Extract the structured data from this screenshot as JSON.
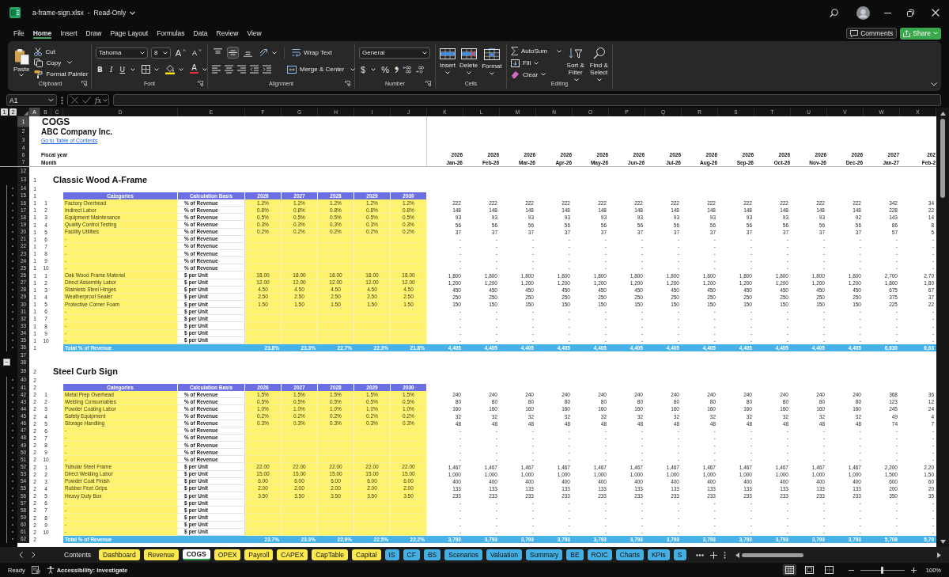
{
  "window": {
    "file_name": "a-frame-sign.xlsx",
    "separator": "-",
    "mode": "Read-Only"
  },
  "menu": {
    "tabs": [
      {
        "label": "File",
        "selected": false
      },
      {
        "label": "Home",
        "selected": true
      },
      {
        "label": "Insert",
        "selected": false
      },
      {
        "label": "Draw",
        "selected": false
      },
      {
        "label": "Page Layout",
        "selected": false
      },
      {
        "label": "Formulas",
        "selected": false
      },
      {
        "label": "Data",
        "selected": false
      },
      {
        "label": "Review",
        "selected": false
      },
      {
        "label": "View",
        "selected": false
      }
    ],
    "comments": "Comments",
    "share": "Share"
  },
  "ribbon": {
    "clipboard": {
      "paste": "Paste",
      "cut": "Cut",
      "copy": "Copy",
      "format_painter": "Format Painter",
      "label": "Clipboard"
    },
    "font": {
      "font_name": "Tahoma",
      "font_size": "8",
      "grow": "A",
      "shrink": "A",
      "bold": "B",
      "italic": "I",
      "underline": "U",
      "font_color": "A",
      "label": "Font"
    },
    "alignment": {
      "vertical": [
        {
          "kind": "top",
          "selected": false
        },
        {
          "kind": "middle",
          "selected": true
        },
        {
          "kind": "bottom",
          "selected": false
        }
      ],
      "wrap_text": "Wrap Text",
      "merge": "Merge & Center",
      "label": "Alignment"
    },
    "number": {
      "format": "General",
      "currency": "$",
      "percent": "%",
      "label": "Number"
    },
    "cells": {
      "insert": "Insert",
      "delete": "Delete",
      "format": "Format",
      "label": "Cells"
    },
    "editing": {
      "autosum": "AutoSum",
      "fill": "Fill",
      "clear": "Clear",
      "sort_filter": "Sort & Filter",
      "find_select": "Find & Select",
      "label": "Editing"
    }
  },
  "formula_bar": {
    "name_box": "A1",
    "function_label": "fx"
  },
  "sheet": {
    "outline_levels": [
      "1",
      "2"
    ],
    "columns": [
      {
        "label": "A",
        "selected": true
      },
      {
        "label": "B",
        "selected": false
      },
      {
        "label": "C",
        "selected": false
      },
      {
        "label": "D",
        "selected": false
      },
      {
        "label": "E",
        "selected": false
      },
      {
        "label": "F",
        "selected": false
      },
      {
        "label": "G",
        "selected": false
      },
      {
        "label": "H",
        "selected": false
      },
      {
        "label": "I",
        "selected": false
      },
      {
        "label": "J",
        "selected": false
      },
      {
        "label": "K",
        "selected": false
      },
      {
        "label": "L",
        "selected": false
      },
      {
        "label": "M",
        "selected": false
      },
      {
        "label": "N",
        "selected": false
      },
      {
        "label": "O",
        "selected": false
      },
      {
        "label": "P",
        "selected": false
      },
      {
        "label": "Q",
        "selected": false
      },
      {
        "label": "R",
        "selected": false
      },
      {
        "label": "S",
        "selected": false
      },
      {
        "label": "T",
        "selected": false
      },
      {
        "label": "U",
        "selected": false
      },
      {
        "label": "V",
        "selected": false
      },
      {
        "label": "W",
        "selected": false
      },
      {
        "label": "X",
        "selected": false
      }
    ],
    "frozen_rows": [
      {
        "number": "1",
        "kind": "title",
        "selected": true,
        "text": "COGS"
      },
      {
        "number": "2",
        "kind": "company",
        "selected": false,
        "text": "ABC Company Inc."
      },
      {
        "number": "3",
        "kind": "link",
        "selected": false,
        "text": "Go to Table of Contents"
      },
      {
        "number": "4",
        "kind": "blank",
        "selected": false
      },
      {
        "number": "6",
        "kind": "label",
        "selected": false,
        "text": "Fiscal year",
        "monthly": [
          "2026",
          "2026",
          "2026",
          "2026",
          "2026",
          "2026",
          "2026",
          "2026",
          "2026",
          "2026",
          "2026",
          "2026",
          "2027",
          "202"
        ]
      },
      {
        "number": "7",
        "kind": "label",
        "selected": false,
        "text": "Month",
        "monthly": [
          "Jan-26",
          "Feb-26",
          "Mar-26",
          "Apr-26",
          "May-26",
          "Jun-26",
          "Jul-26",
          "Aug-26",
          "Sep-26",
          "Oct-26",
          "Nov-26",
          "Dec-26",
          "Jan-27",
          "Feb-2"
        ]
      }
    ],
    "rows": [
      {
        "number": "12",
        "kind": "blank",
        "selected": false
      },
      {
        "number": "13",
        "kind": "section",
        "selected": false,
        "group": "1",
        "text": "Classic Wood A-Frame"
      },
      {
        "number": "14",
        "kind": "blank",
        "selected": false,
        "group": "1"
      },
      {
        "number": "15",
        "kind": "header",
        "selected": false,
        "group": "1",
        "category": "Categories",
        "basis": "Calculation Basis",
        "annual": [
          "2026",
          "2027",
          "2028",
          "2029",
          "2030"
        ]
      },
      {
        "number": "16",
        "kind": "item",
        "selected": false,
        "group": "1",
        "index": "1",
        "category": "Factory Overhead",
        "basis": "% of Revenue",
        "annual": [
          "1.2%",
          "1.2%",
          "1.2%",
          "1.2%",
          "1.2%"
        ],
        "monthly": [
          "222",
          "222",
          "222",
          "222",
          "222",
          "222",
          "222",
          "222",
          "222",
          "222",
          "222",
          "222",
          "342",
          "34"
        ]
      },
      {
        "number": "17",
        "kind": "item",
        "selected": false,
        "group": "1",
        "index": "2",
        "category": "Indirect Labor",
        "basis": "% of Revenue",
        "annual": [
          "0.8%",
          "0.8%",
          "0.8%",
          "0.8%",
          "0.8%"
        ],
        "monthly": [
          "148",
          "148",
          "148",
          "148",
          "148",
          "148",
          "148",
          "148",
          "148",
          "148",
          "148",
          "148",
          "228",
          "22"
        ]
      },
      {
        "number": "18",
        "kind": "item",
        "selected": false,
        "group": "1",
        "index": "3",
        "category": "Equipment Maintenance",
        "basis": "% of Revenue",
        "annual": [
          "0.5%",
          "0.5%",
          "0.5%",
          "0.5%",
          "0.5%"
        ],
        "monthly": [
          "93",
          "93",
          "93",
          "93",
          "93",
          "93",
          "93",
          "93",
          "93",
          "93",
          "93",
          "92",
          "143",
          "14"
        ]
      },
      {
        "number": "19",
        "kind": "item",
        "selected": false,
        "group": "1",
        "index": "4",
        "category": "Quality Control Testing",
        "basis": "% of Revenue",
        "annual": [
          "0.3%",
          "0.3%",
          "0.3%",
          "0.3%",
          "0.3%"
        ],
        "monthly": [
          "56",
          "56",
          "56",
          "56",
          "56",
          "56",
          "56",
          "56",
          "56",
          "56",
          "56",
          "56",
          "86",
          "8"
        ]
      },
      {
        "number": "20",
        "kind": "item",
        "selected": false,
        "group": "1",
        "index": "5",
        "category": "Facility Utilities",
        "basis": "% of Revenue",
        "annual": [
          "0.2%",
          "0.2%",
          "0.2%",
          "0.2%",
          "0.2%"
        ],
        "monthly": [
          "37",
          "37",
          "37",
          "37",
          "37",
          "37",
          "37",
          "37",
          "37",
          "37",
          "37",
          "37",
          "57",
          "5"
        ]
      },
      {
        "number": "21",
        "kind": "item",
        "selected": false,
        "group": "1",
        "index": "6",
        "category": "-",
        "basis": "% of Revenue",
        "monthly": [
          "-",
          "-",
          "-",
          "-",
          "-",
          "-",
          "-",
          "-",
          "-",
          "-",
          "-",
          "-",
          "-",
          "-"
        ]
      },
      {
        "number": "22",
        "kind": "item",
        "selected": false,
        "group": "1",
        "index": "7",
        "category": "-",
        "basis": "% of Revenue",
        "monthly": [
          "-",
          "-",
          "-",
          "-",
          "-",
          "-",
          "-",
          "-",
          "-",
          "-",
          "-",
          "-",
          "-",
          "-"
        ]
      },
      {
        "number": "23",
        "kind": "item",
        "selected": false,
        "group": "1",
        "index": "8",
        "category": "-",
        "basis": "% of Revenue",
        "monthly": [
          "-",
          "-",
          "-",
          "-",
          "-",
          "-",
          "-",
          "-",
          "-",
          "-",
          "-",
          "-",
          "-",
          "-"
        ]
      },
      {
        "number": "24",
        "kind": "item",
        "selected": false,
        "group": "1",
        "index": "9",
        "category": "-",
        "basis": "% of Revenue",
        "monthly": [
          "-",
          "-",
          "-",
          "-",
          "-",
          "-",
          "-",
          "-",
          "-",
          "-",
          "-",
          "-",
          "-",
          "-"
        ]
      },
      {
        "number": "25",
        "kind": "item",
        "selected": false,
        "group": "1",
        "index": "10",
        "category": "-",
        "basis": "% of Revenue",
        "monthly": [
          "-",
          "-",
          "-",
          "-",
          "-",
          "-",
          "-",
          "-",
          "-",
          "-",
          "-",
          "-",
          "-",
          "-"
        ]
      },
      {
        "number": "26",
        "kind": "item",
        "selected": false,
        "group": "1",
        "index": "1",
        "category": "Oak Wood Frame Material",
        "basis": "$ per Unit",
        "annual": [
          "18.00",
          "18.00",
          "18.00",
          "18.00",
          "18.00"
        ],
        "monthly": [
          "1,800",
          "1,800",
          "1,800",
          "1,800",
          "1,800",
          "1,800",
          "1,800",
          "1,800",
          "1,800",
          "1,800",
          "1,800",
          "1,800",
          "2,700",
          "2,70"
        ]
      },
      {
        "number": "27",
        "kind": "item",
        "selected": false,
        "group": "1",
        "index": "2",
        "category": "Direct Assembly Labor",
        "basis": "$ per Unit",
        "annual": [
          "12.00",
          "12.00",
          "12.00",
          "12.00",
          "12.00"
        ],
        "monthly": [
          "1,200",
          "1,200",
          "1,200",
          "1,200",
          "1,200",
          "1,200",
          "1,200",
          "1,200",
          "1,200",
          "1,200",
          "1,200",
          "1,200",
          "1,800",
          "1,80"
        ]
      },
      {
        "number": "28",
        "kind": "item",
        "selected": false,
        "group": "1",
        "index": "3",
        "category": "Stainless Steel Hinges",
        "basis": "$ per Unit",
        "annual": [
          "4.50",
          "4.50",
          "4.50",
          "4.50",
          "4.50"
        ],
        "monthly": [
          "450",
          "450",
          "450",
          "450",
          "450",
          "450",
          "450",
          "450",
          "450",
          "450",
          "450",
          "450",
          "675",
          "67"
        ]
      },
      {
        "number": "29",
        "kind": "item",
        "selected": false,
        "group": "1",
        "index": "4",
        "category": "Weatherproof Sealer",
        "basis": "$ per Unit",
        "annual": [
          "2.50",
          "2.50",
          "2.50",
          "2.50",
          "2.50"
        ],
        "monthly": [
          "250",
          "250",
          "250",
          "250",
          "250",
          "250",
          "250",
          "250",
          "250",
          "250",
          "250",
          "250",
          "375",
          "37"
        ]
      },
      {
        "number": "30",
        "kind": "item",
        "selected": false,
        "group": "1",
        "index": "5",
        "category": "Protective Corner Foam",
        "basis": "$ per Unit",
        "annual": [
          "1.50",
          "1.50",
          "1.50",
          "1.50",
          "1.50"
        ],
        "monthly": [
          "150",
          "150",
          "150",
          "150",
          "150",
          "150",
          "150",
          "150",
          "150",
          "150",
          "150",
          "150",
          "225",
          "22"
        ]
      },
      {
        "number": "31",
        "kind": "item",
        "selected": false,
        "group": "1",
        "index": "6",
        "category": "-",
        "basis": "$ per Unit",
        "monthly": [
          "-",
          "-",
          "-",
          "-",
          "-",
          "-",
          "-",
          "-",
          "-",
          "-",
          "-",
          "-",
          "-",
          "-"
        ]
      },
      {
        "number": "32",
        "kind": "item",
        "selected": false,
        "group": "1",
        "index": "7",
        "category": "-",
        "basis": "$ per Unit",
        "monthly": [
          "-",
          "-",
          "-",
          "-",
          "-",
          "-",
          "-",
          "-",
          "-",
          "-",
          "-",
          "-",
          "-",
          "-"
        ]
      },
      {
        "number": "33",
        "kind": "item",
        "selected": false,
        "group": "1",
        "index": "8",
        "category": "-",
        "basis": "$ per Unit",
        "monthly": [
          "-",
          "-",
          "-",
          "-",
          "-",
          "-",
          "-",
          "-",
          "-",
          "-",
          "-",
          "-",
          "-",
          "-"
        ]
      },
      {
        "number": "34",
        "kind": "item",
        "selected": false,
        "group": "1",
        "index": "9",
        "category": "-",
        "basis": "$ per Unit",
        "monthly": [
          "-",
          "-",
          "-",
          "-",
          "-",
          "-",
          "-",
          "-",
          "-",
          "-",
          "-",
          "-",
          "-",
          "-"
        ]
      },
      {
        "number": "35",
        "kind": "item",
        "selected": false,
        "group": "1",
        "index": "10",
        "category": "-",
        "basis": "$ per Unit",
        "monthly": [
          "-",
          "-",
          "-",
          "-",
          "-",
          "-",
          "-",
          "-",
          "-",
          "-",
          "-",
          "-",
          "-",
          "-"
        ]
      },
      {
        "number": "36",
        "kind": "total",
        "selected": false,
        "group": "1",
        "category": "Total % of Revenue",
        "annual": [
          "23.8%",
          "23.3%",
          "22.7%",
          "22.3%",
          "21.8%"
        ],
        "monthly": [
          "4,405",
          "4,405",
          "4,405",
          "4,405",
          "4,405",
          "4,405",
          "4,405",
          "4,405",
          "4,405",
          "4,405",
          "4,405",
          "4,405",
          "6,630",
          "6,63"
        ]
      },
      {
        "number": "37",
        "kind": "blank",
        "selected": false
      },
      {
        "number": "38",
        "kind": "blank",
        "selected": false,
        "outline_toggle": "−"
      },
      {
        "number": "39",
        "kind": "section",
        "selected": false,
        "group": "2",
        "text": "Steel Curb Sign"
      },
      {
        "number": "40",
        "kind": "blank",
        "selected": false,
        "group": "2"
      },
      {
        "number": "41",
        "kind": "header",
        "selected": false,
        "group": "2",
        "category": "Categories",
        "basis": "Calculation Basis",
        "annual": [
          "2026",
          "2027",
          "2028",
          "2029",
          "2030"
        ]
      },
      {
        "number": "42",
        "kind": "item",
        "selected": false,
        "group": "2",
        "index": "1",
        "category": "Metal Prep Overhead",
        "basis": "% of Revenue",
        "annual": [
          "1.5%",
          "1.5%",
          "1.5%",
          "1.5%",
          "1.5%"
        ],
        "monthly": [
          "240",
          "240",
          "240",
          "240",
          "240",
          "240",
          "240",
          "240",
          "240",
          "240",
          "240",
          "240",
          "368",
          "36"
        ]
      },
      {
        "number": "43",
        "kind": "item",
        "selected": false,
        "group": "2",
        "index": "2",
        "category": "Welding Consumables",
        "basis": "% of Revenue",
        "annual": [
          "0.5%",
          "0.5%",
          "0.5%",
          "0.5%",
          "0.5%"
        ],
        "monthly": [
          "80",
          "80",
          "80",
          "80",
          "80",
          "80",
          "80",
          "80",
          "80",
          "80",
          "80",
          "80",
          "123",
          "12"
        ]
      },
      {
        "number": "44",
        "kind": "item",
        "selected": false,
        "group": "2",
        "index": "3",
        "category": "Powder Coating Labor",
        "basis": "% of Revenue",
        "annual": [
          "1.0%",
          "1.0%",
          "1.0%",
          "1.0%",
          "1.0%"
        ],
        "monthly": [
          "160",
          "160",
          "160",
          "160",
          "160",
          "160",
          "160",
          "160",
          "160",
          "160",
          "160",
          "160",
          "245",
          "24"
        ]
      },
      {
        "number": "45",
        "kind": "item",
        "selected": false,
        "group": "2",
        "index": "4",
        "category": "Safety Equipment",
        "basis": "% of Revenue",
        "annual": [
          "0.2%",
          "0.2%",
          "0.2%",
          "0.2%",
          "0.2%"
        ],
        "monthly": [
          "32",
          "32",
          "32",
          "32",
          "32",
          "32",
          "32",
          "32",
          "32",
          "32",
          "32",
          "32",
          "49",
          "4"
        ]
      },
      {
        "number": "46",
        "kind": "item",
        "selected": false,
        "group": "2",
        "index": "5",
        "category": "Storage Handling",
        "basis": "% of Revenue",
        "annual": [
          "0.3%",
          "0.3%",
          "0.3%",
          "0.3%",
          "0.3%"
        ],
        "monthly": [
          "48",
          "48",
          "48",
          "48",
          "48",
          "48",
          "48",
          "48",
          "48",
          "48",
          "48",
          "48",
          "74",
          "7"
        ]
      },
      {
        "number": "47",
        "kind": "item",
        "selected": false,
        "group": "2",
        "index": "6",
        "category": "-",
        "basis": "% of Revenue",
        "monthly": [
          "-",
          "-",
          "-",
          "-",
          "-",
          "-",
          "-",
          "-",
          "-",
          "-",
          "-",
          "-",
          "-",
          "-"
        ]
      },
      {
        "number": "48",
        "kind": "item",
        "selected": false,
        "group": "2",
        "index": "7",
        "category": "-",
        "basis": "% of Revenue",
        "monthly": [
          "-",
          "-",
          "-",
          "-",
          "-",
          "-",
          "-",
          "-",
          "-",
          "-",
          "-",
          "-",
          "-",
          "-"
        ]
      },
      {
        "number": "49",
        "kind": "item",
        "selected": false,
        "group": "2",
        "index": "8",
        "category": "-",
        "basis": "% of Revenue",
        "monthly": [
          "-",
          "-",
          "-",
          "-",
          "-",
          "-",
          "-",
          "-",
          "-",
          "-",
          "-",
          "-",
          "-",
          "-"
        ]
      },
      {
        "number": "50",
        "kind": "item",
        "selected": false,
        "group": "2",
        "index": "9",
        "category": "-",
        "basis": "% of Revenue",
        "monthly": [
          "-",
          "-",
          "-",
          "-",
          "-",
          "-",
          "-",
          "-",
          "-",
          "-",
          "-",
          "-",
          "-",
          "-"
        ]
      },
      {
        "number": "51",
        "kind": "item",
        "selected": false,
        "group": "2",
        "index": "10",
        "category": "-",
        "basis": "% of Revenue",
        "monthly": [
          "-",
          "-",
          "-",
          "-",
          "-",
          "-",
          "-",
          "-",
          "-",
          "-",
          "-",
          "-",
          "-",
          "-"
        ]
      },
      {
        "number": "52",
        "kind": "item",
        "selected": false,
        "group": "2",
        "index": "1",
        "category": "Tubular Steel Frame",
        "basis": "$ per Unit",
        "annual": [
          "22.00",
          "22.00",
          "22.00",
          "22.00",
          "22.00"
        ],
        "monthly": [
          "1,467",
          "1,467",
          "1,467",
          "1,467",
          "1,467",
          "1,467",
          "1,467",
          "1,467",
          "1,467",
          "1,467",
          "1,467",
          "1,467",
          "2,200",
          "2,20"
        ]
      },
      {
        "number": "53",
        "kind": "item",
        "selected": false,
        "group": "2",
        "index": "2",
        "category": "Direct Welding Labor",
        "basis": "$ per Unit",
        "annual": [
          "15.00",
          "15.00",
          "15.00",
          "15.00",
          "15.00"
        ],
        "monthly": [
          "1,000",
          "1,000",
          "1,000",
          "1,000",
          "1,000",
          "1,000",
          "1,000",
          "1,000",
          "1,000",
          "1,000",
          "1,000",
          "1,000",
          "1,500",
          "1,50"
        ]
      },
      {
        "number": "54",
        "kind": "item",
        "selected": false,
        "group": "2",
        "index": "3",
        "category": "Powder Coat Finish",
        "basis": "$ per Unit",
        "annual": [
          "6.00",
          "6.00",
          "6.00",
          "6.00",
          "6.00"
        ],
        "monthly": [
          "400",
          "400",
          "400",
          "400",
          "400",
          "400",
          "400",
          "400",
          "400",
          "400",
          "400",
          "400",
          "600",
          "60"
        ]
      },
      {
        "number": "55",
        "kind": "item",
        "selected": false,
        "group": "2",
        "index": "4",
        "category": "Rubber Feet Grips",
        "basis": "$ per Unit",
        "annual": [
          "2.00",
          "2.00",
          "2.00",
          "2.00",
          "2.00"
        ],
        "monthly": [
          "133",
          "133",
          "133",
          "133",
          "133",
          "133",
          "133",
          "133",
          "133",
          "133",
          "133",
          "133",
          "200",
          "20"
        ]
      },
      {
        "number": "56",
        "kind": "item",
        "selected": false,
        "group": "2",
        "index": "5",
        "category": "Heavy Duty Box",
        "basis": "$ per Unit",
        "annual": [
          "3.50",
          "3.50",
          "3.50",
          "3.50",
          "3.50"
        ],
        "monthly": [
          "233",
          "233",
          "233",
          "233",
          "233",
          "233",
          "233",
          "233",
          "233",
          "233",
          "233",
          "233",
          "350",
          "35"
        ]
      },
      {
        "number": "57",
        "kind": "item",
        "selected": false,
        "group": "2",
        "index": "6",
        "category": "-",
        "basis": "$ per Unit",
        "monthly": [
          "-",
          "-",
          "-",
          "-",
          "-",
          "-",
          "-",
          "-",
          "-",
          "-",
          "-",
          "-",
          "-",
          "-"
        ]
      },
      {
        "number": "58",
        "kind": "item",
        "selected": false,
        "group": "2",
        "index": "7",
        "category": "-",
        "basis": "$ per Unit",
        "monthly": [
          "-",
          "-",
          "-",
          "-",
          "-",
          "-",
          "-",
          "-",
          "-",
          "-",
          "-",
          "-",
          "-",
          "-"
        ]
      },
      {
        "number": "59",
        "kind": "item",
        "selected": false,
        "group": "2",
        "index": "8",
        "category": "-",
        "basis": "$ per Unit",
        "monthly": [
          "-",
          "-",
          "-",
          "-",
          "-",
          "-",
          "-",
          "-",
          "-",
          "-",
          "-",
          "-",
          "-",
          "-"
        ]
      },
      {
        "number": "60",
        "kind": "item",
        "selected": false,
        "group": "2",
        "index": "9",
        "category": "-",
        "basis": "$ per Unit",
        "monthly": [
          "-",
          "-",
          "-",
          "-",
          "-",
          "-",
          "-",
          "-",
          "-",
          "-",
          "-",
          "-",
          "-",
          "-"
        ]
      },
      {
        "number": "61",
        "kind": "item",
        "selected": false,
        "group": "2",
        "index": "10",
        "category": "-",
        "basis": "$ per Unit",
        "monthly": [
          "-",
          "-",
          "-",
          "-",
          "-",
          "-",
          "-",
          "-",
          "-",
          "-",
          "-",
          "-",
          "-",
          "-"
        ]
      },
      {
        "number": "62",
        "kind": "total",
        "selected": false,
        "group": "2",
        "category": "Total % of Revenue",
        "annual": [
          "23.7%",
          "23.3%",
          "22.9%",
          "22.5%",
          "22.2%"
        ],
        "monthly": [
          "3,793",
          "3,793",
          "3,793",
          "3,793",
          "3,793",
          "3,793",
          "3,793",
          "3,793",
          "3,793",
          "3,793",
          "3,793",
          "3,793",
          "5,708",
          "5,70"
        ]
      }
    ]
  },
  "sheet_tabs": {
    "tabs": [
      {
        "label": "Contents",
        "selected": false
      },
      {
        "label": "Dashboard",
        "selected": false,
        "color": "#fbe84e"
      },
      {
        "label": "Revenue",
        "selected": false,
        "color": "#fbe84e"
      },
      {
        "label": "COGS",
        "selected": true
      },
      {
        "label": "OPEX",
        "selected": false,
        "color": "#fbe84e"
      },
      {
        "label": "Payroll",
        "selected": false,
        "color": "#fbe84e"
      },
      {
        "label": "CAPEX",
        "selected": false,
        "color": "#fbe84e"
      },
      {
        "label": "CapTable",
        "selected": false,
        "color": "#fbe84e"
      },
      {
        "label": "Capital",
        "selected": false,
        "color": "#fbe84e"
      },
      {
        "label": "IS",
        "selected": false,
        "color": "#45afe4"
      },
      {
        "label": "CF",
        "selected": false,
        "color": "#45afe4"
      },
      {
        "label": "BS",
        "selected": false,
        "color": "#45afe4"
      },
      {
        "label": "Scenarios",
        "selected": false,
        "color": "#45afe4"
      },
      {
        "label": "Valuation",
        "selected": false,
        "color": "#45afe4"
      },
      {
        "label": "Summary",
        "selected": false,
        "color": "#45afe4"
      },
      {
        "label": "BE",
        "selected": false,
        "color": "#45afe4"
      },
      {
        "label": "ROIC",
        "selected": false,
        "color": "#45afe4"
      },
      {
        "label": "Charts",
        "selected": false,
        "color": "#45afe4"
      },
      {
        "label": "KPIs",
        "selected": false,
        "color": "#45afe4"
      },
      {
        "label": "S",
        "selected": false,
        "color": "#45afe4"
      }
    ]
  },
  "status_bar": {
    "status": "Ready",
    "accessibility": "Accessibility: Investigate",
    "views": [
      {
        "kind": "normal",
        "selected": true
      },
      {
        "kind": "page-layout",
        "selected": false
      },
      {
        "kind": "page-break",
        "selected": false
      }
    ],
    "zoom": {
      "level": 0.5
    },
    "zoom_label": "100%"
  }
}
